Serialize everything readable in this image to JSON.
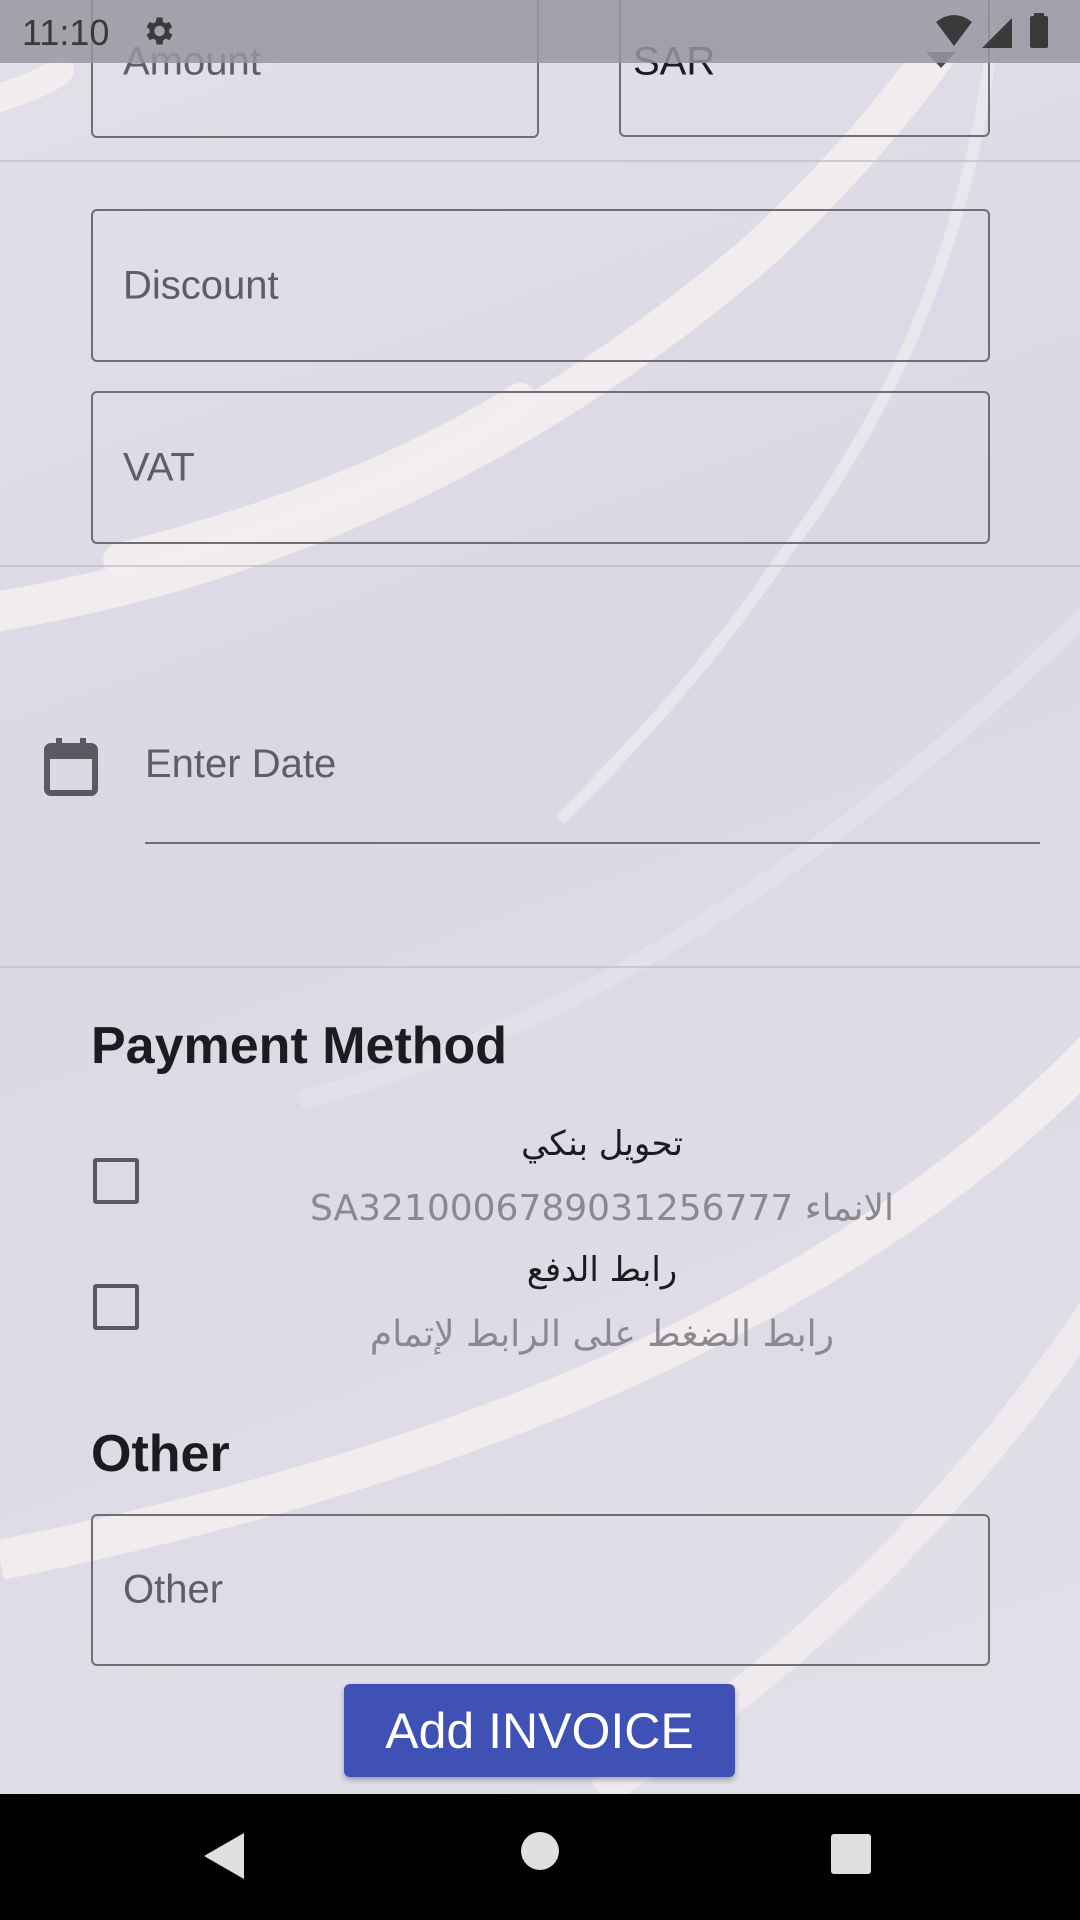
{
  "status_bar": {
    "time": "11:10",
    "icons": [
      "gear-icon",
      "wifi-icon",
      "signal-icon",
      "battery-icon"
    ]
  },
  "form": {
    "amount_placeholder": "Amount",
    "currency_value": "SAR",
    "discount_placeholder": "Discount",
    "vat_placeholder": "VAT",
    "date_placeholder": "Enter Date"
  },
  "payment": {
    "heading": "Payment Method",
    "methods": [
      {
        "title": "تحويل بنكي",
        "subtitle": "SA3210006789031256777 الانماء",
        "checked": false
      },
      {
        "title": "رابط الدفع",
        "subtitle": "رابط الضغط على الرابط لإتمام",
        "checked": false
      }
    ]
  },
  "other": {
    "heading": "Other",
    "placeholder": "Other"
  },
  "actions": {
    "add_invoice_label": "Add INVOICE"
  },
  "colors": {
    "accent": "#3f51b5",
    "background": "#dcdae4"
  }
}
